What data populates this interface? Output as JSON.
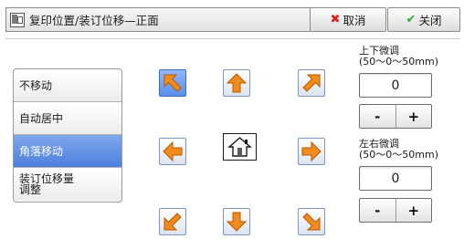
{
  "header": {
    "title": "复印位置/装订位移—正面",
    "cancel_label": "取消",
    "close_label": "关闭"
  },
  "options": [
    {
      "label": "不移动",
      "selected": false
    },
    {
      "label": "自动居中",
      "selected": false
    },
    {
      "label": "角落移动",
      "selected": true
    },
    {
      "label_line1": "装订位移量",
      "label_line2": "调整",
      "selected": false
    }
  ],
  "arrows": {
    "up_left": "arrow-up-left-icon",
    "up": "arrow-up-icon",
    "up_right": "arrow-up-right-icon",
    "left": "arrow-left-icon",
    "center": "home-icon",
    "right": "arrow-right-icon",
    "down_left": "arrow-down-left-icon",
    "down": "arrow-down-icon",
    "down_right": "arrow-down-right-icon",
    "selected": "up_left"
  },
  "vertical_adjust": {
    "label_line1": "上下微调",
    "label_line2": "(50～0～50mm)",
    "value": "0",
    "minus": "-",
    "plus": "+"
  },
  "horizontal_adjust": {
    "label_line1": "左右微调",
    "label_line2": "(50～0～50mm)",
    "value": "0",
    "minus": "-",
    "plus": "+"
  },
  "colors": {
    "selected_blue": "#5b8fe8",
    "arrow_orange": "#f28a1e",
    "cancel_red": "#e0201a",
    "check_green": "#3aa63a"
  }
}
